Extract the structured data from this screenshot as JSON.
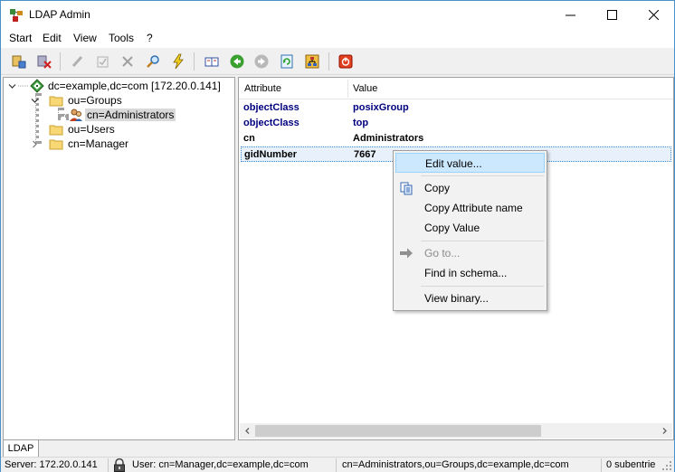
{
  "window": {
    "title": "LDAP Admin"
  },
  "menu": [
    "Start",
    "Edit",
    "View",
    "Tools",
    "?"
  ],
  "tree": {
    "root": "dc=example,dc=com [172.20.0.141]",
    "groups": "ou=Groups",
    "administrators": "cn=Administrators",
    "users": "ou=Users",
    "manager": "cn=Manager"
  },
  "attributes": {
    "header": {
      "attribute": "Attribute",
      "value": "Value"
    },
    "rows": [
      {
        "name": "objectClass",
        "value": "posixGroup"
      },
      {
        "name": "objectClass",
        "value": "top"
      },
      {
        "name": "cn",
        "value": "Administrators"
      },
      {
        "name": "gidNumber",
        "value": "7667"
      }
    ]
  },
  "context_menu": {
    "edit_value": "Edit value...",
    "copy": "Copy",
    "copy_attr": "Copy Attribute name",
    "copy_value": "Copy Value",
    "go_to": "Go to...",
    "find_schema": "Find in schema...",
    "view_binary": "View binary..."
  },
  "tabs": [
    "LDAP"
  ],
  "status": {
    "server": "Server: 172.20.0.141",
    "user": "User: cn=Manager,dc=example,dc=com",
    "dn": "cn=Administrators,ou=Groups,dc=example,dc=com",
    "subentries": "0 subentrie"
  }
}
